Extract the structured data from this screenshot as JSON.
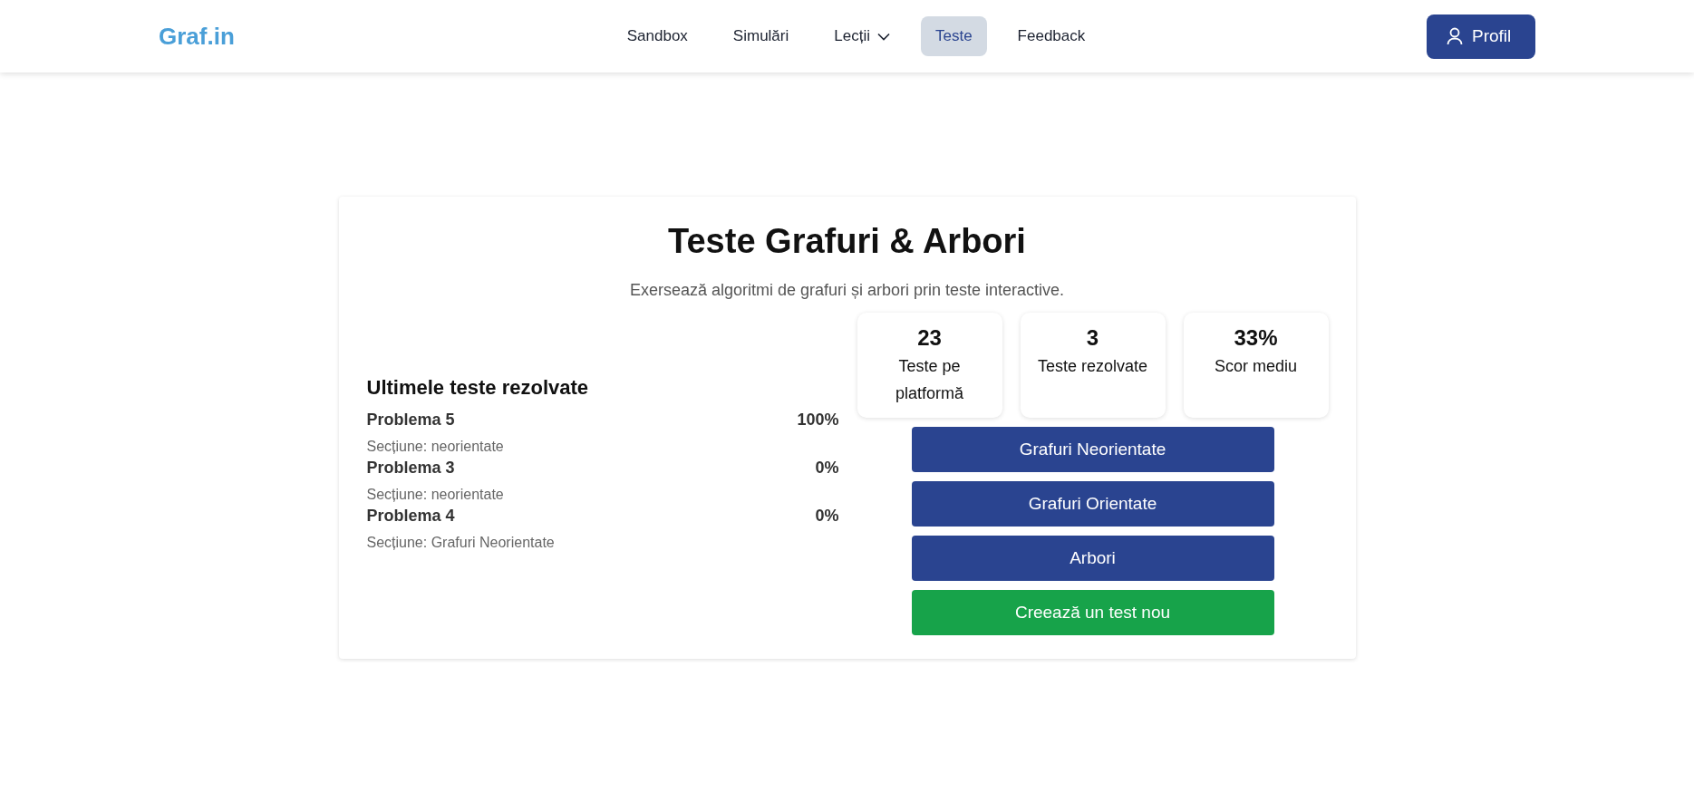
{
  "header": {
    "logo": "Graf.in",
    "nav": [
      {
        "label": "Sandbox",
        "kind": "link",
        "selected": false
      },
      {
        "label": "Simulări",
        "kind": "link",
        "selected": false
      },
      {
        "label": "Lecții",
        "kind": "dropdown",
        "selected": false
      },
      {
        "label": "Teste",
        "kind": "link",
        "selected": true
      },
      {
        "label": "Feedback",
        "kind": "link",
        "selected": false
      }
    ],
    "profile_button": "Profil"
  },
  "card": {
    "title": "Teste Grafuri & Arbori",
    "subtitle": "Exersează algoritmi de grafuri și arbori prin teste interactive.",
    "recent": {
      "heading": "Ultimele teste rezolvate",
      "items": [
        {
          "name": "Problema 5",
          "score": "100%",
          "section": "Secțiune: neorientate"
        },
        {
          "name": "Problema 3",
          "score": "0%",
          "section": "Secțiune: neorientate"
        },
        {
          "name": "Problema 4",
          "score": "0%",
          "section": "Secțiune: Grafuri Neorientate"
        }
      ]
    },
    "stats": [
      {
        "value": "23",
        "label": "Teste pe platformă"
      },
      {
        "value": "3",
        "label": "Teste rezolvate"
      },
      {
        "value": "33%",
        "label": "Scor mediu"
      }
    ],
    "buttons": [
      {
        "label": "Grafuri Neorientate",
        "kind": "primary"
      },
      {
        "label": "Grafuri Orientate",
        "kind": "primary"
      },
      {
        "label": "Arbori",
        "kind": "primary"
      },
      {
        "label": "Creează un test nou",
        "kind": "success"
      }
    ]
  }
}
